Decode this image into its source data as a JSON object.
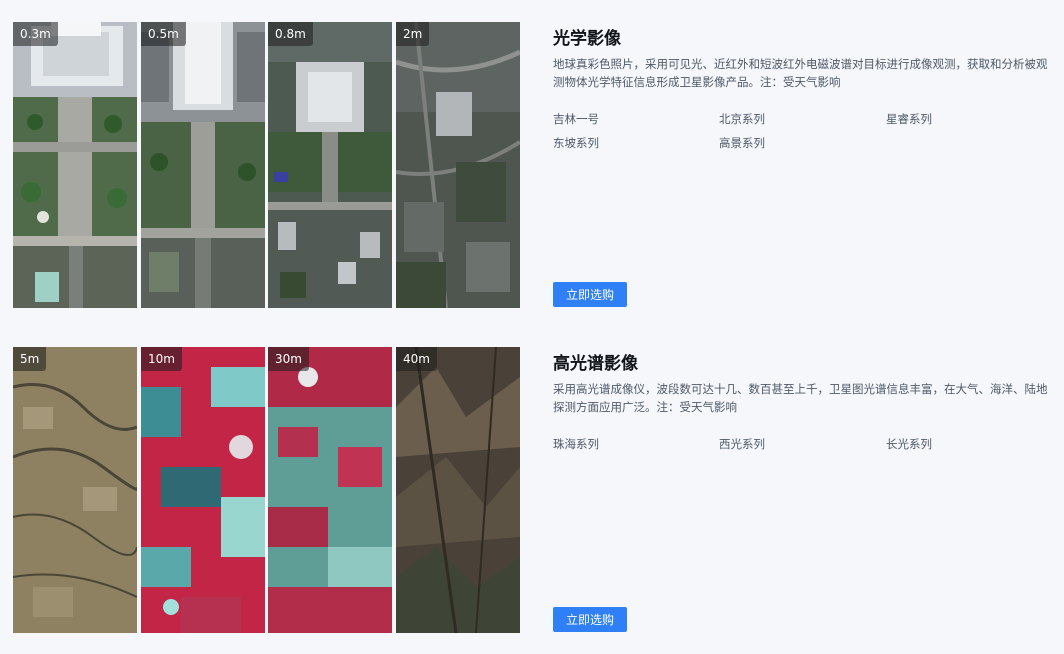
{
  "optical": {
    "title": "光学影像",
    "description": "地球真彩色照片，采用可见光、近红外和短波红外电磁波谱对目标进行成像观测，获取和分析被观测物体光学特征信息形成卫星影像产品。注：受天气影响",
    "tiles": [
      "0.3m",
      "0.5m",
      "0.8m",
      "2m"
    ],
    "series": [
      "吉林一号",
      "北京系列",
      "星睿系列",
      "东坡系列",
      "高景系列"
    ],
    "buy_label": "立即选购"
  },
  "hyperspectral": {
    "title": "高光谱影像",
    "description": "采用高光谱成像仪，波段数可达十几、数百甚至上千，卫星图光谱信息丰富，在大气、海洋、陆地探测方面应用广泛。注：受天气影响",
    "tiles": [
      "5m",
      "10m",
      "30m",
      "40m"
    ],
    "series": [
      "珠海系列",
      "西光系列",
      "长光系列"
    ],
    "buy_label": "立即选购"
  }
}
